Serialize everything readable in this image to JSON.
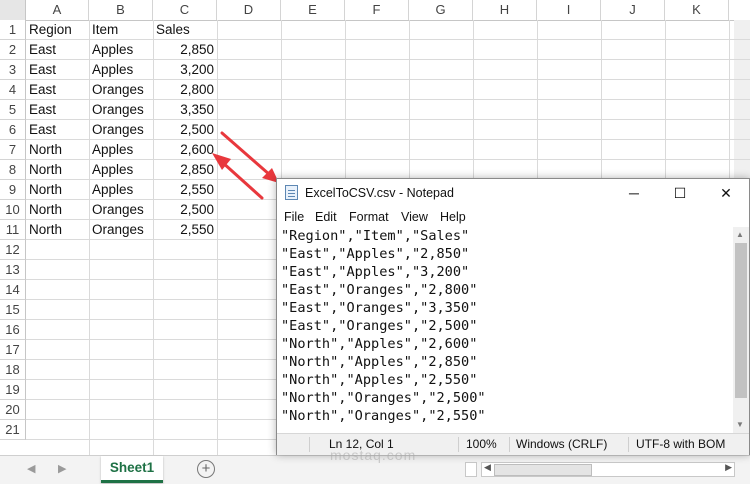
{
  "excel": {
    "columns": [
      "A",
      "B",
      "C",
      "D",
      "E",
      "F",
      "G",
      "H",
      "I",
      "J",
      "K"
    ],
    "row_numbers": [
      "1",
      "2",
      "3",
      "4",
      "5",
      "6",
      "7",
      "8",
      "9",
      "10",
      "11",
      "12",
      "13",
      "14",
      "15",
      "16",
      "17",
      "18",
      "19",
      "20",
      "21"
    ],
    "rows": [
      [
        "Region",
        "Item",
        "Sales"
      ],
      [
        "East",
        "Apples",
        "2,850"
      ],
      [
        "East",
        "Apples",
        "3,200"
      ],
      [
        "East",
        "Oranges",
        "2,800"
      ],
      [
        "East",
        "Oranges",
        "3,350"
      ],
      [
        "East",
        "Oranges",
        "2,500"
      ],
      [
        "North",
        "Apples",
        "2,600"
      ],
      [
        "North",
        "Apples",
        "2,850"
      ],
      [
        "North",
        "Apples",
        "2,550"
      ],
      [
        "North",
        "Oranges",
        "2,500"
      ],
      [
        "North",
        "Oranges",
        "2,550"
      ]
    ],
    "sheet_tab": "Sheet1",
    "add_sheet_icon": "plus-circle-icon",
    "accent_color": "#1e7145"
  },
  "notepad": {
    "title": "ExcelToCSV.csv - Notepad",
    "menu": [
      "File",
      "Edit",
      "Format",
      "View",
      "Help"
    ],
    "lines": [
      "\"Region\",\"Item\",\"Sales\"",
      "\"East\",\"Apples\",\"2,850\"",
      "\"East\",\"Apples\",\"3,200\"",
      "\"East\",\"Oranges\",\"2,800\"",
      "\"East\",\"Oranges\",\"3,350\"",
      "\"East\",\"Oranges\",\"2,500\"",
      "\"North\",\"Apples\",\"2,600\"",
      "\"North\",\"Apples\",\"2,850\"",
      "\"North\",\"Apples\",\"2,550\"",
      "\"North\",\"Oranges\",\"2,500\"",
      "\"North\",\"Oranges\",\"2,550\""
    ],
    "status": {
      "position": "Ln 12, Col 1",
      "zoom": "100%",
      "line_ending": "Windows (CRLF)",
      "encoding": "UTF-8 with BOM"
    },
    "window_buttons": {
      "minimize": "─",
      "maximize": "☐",
      "close": "✕"
    }
  },
  "annotation": {
    "arrow_color": "#e8383d"
  },
  "watermark": "mostaq.com"
}
